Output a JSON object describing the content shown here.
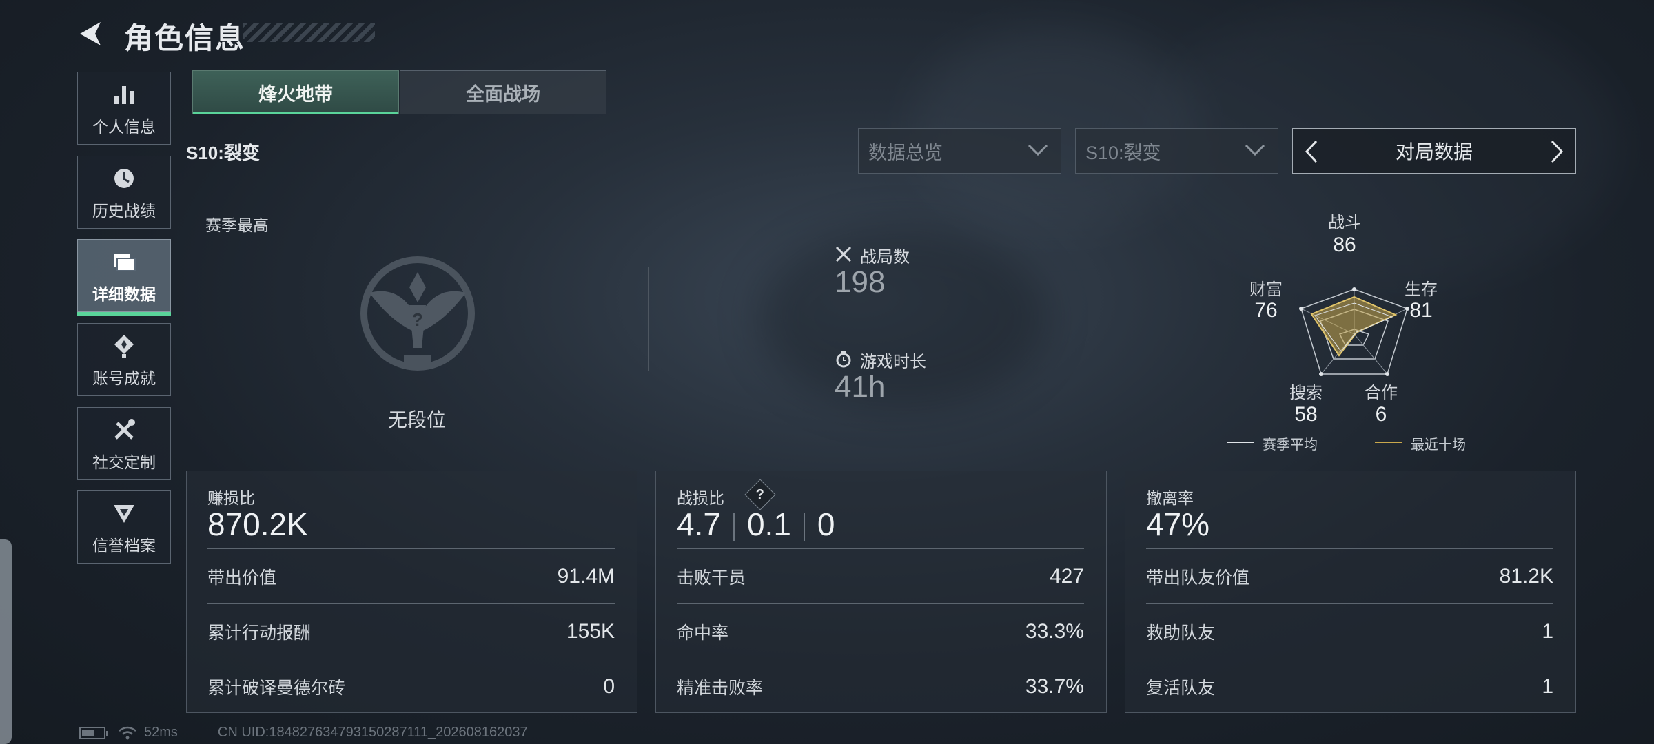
{
  "header": {
    "title": "角色信息"
  },
  "sidebar": {
    "items": [
      {
        "label": "个人信息",
        "icon": "bar-chart-icon",
        "active": false
      },
      {
        "label": "历史战绩",
        "icon": "history-icon",
        "active": false
      },
      {
        "label": "详细数据",
        "icon": "folder-icon",
        "active": true
      },
      {
        "label": "账号成就",
        "icon": "achievement-icon",
        "active": false
      },
      {
        "label": "社交定制",
        "icon": "tools-icon",
        "active": false
      },
      {
        "label": "信誉档案",
        "icon": "reputation-icon",
        "active": false
      }
    ]
  },
  "mode_tabs": [
    {
      "label": "烽火地带",
      "active": true
    },
    {
      "label": "全面战场",
      "active": false
    }
  ],
  "season": {
    "label": "S10:裂变"
  },
  "filters": {
    "overview": "数据总览",
    "season": "S10:裂变",
    "match_data": "对局数据"
  },
  "summary": {
    "season_best_label": "赛季最高",
    "rank": "无段位",
    "matches_label": "战局数",
    "matches_value": "198",
    "playtime_label": "游戏时长",
    "playtime_value": "41h"
  },
  "radar": {
    "axes": [
      {
        "label": "战斗",
        "value": "86"
      },
      {
        "label": "生存",
        "value": "81"
      },
      {
        "label": "合作",
        "value": "6"
      },
      {
        "label": "搜索",
        "value": "58"
      },
      {
        "label": "财富",
        "value": "76"
      }
    ],
    "legend_avg": "赛季平均",
    "legend_recent": "最近十场",
    "recent_color": "#c9a84c",
    "avg_color": "#e0e4e8"
  },
  "panels": {
    "profit": {
      "title": "赚损比",
      "big": "870.2K",
      "rows": [
        {
          "k": "带出价值",
          "v": "91.4M"
        },
        {
          "k": "累计行动报酬",
          "v": "155K"
        },
        {
          "k": "累计破译曼德尔砖",
          "v": "0"
        }
      ]
    },
    "kd": {
      "title": "战损比",
      "help": "?",
      "big_values": [
        "4.7",
        "0.1",
        "0"
      ],
      "rows": [
        {
          "k": "击败干员",
          "v": "427"
        },
        {
          "k": "命中率",
          "v": "33.3%"
        },
        {
          "k": "精准击败率",
          "v": "33.7%"
        }
      ]
    },
    "extract": {
      "title": "撤离率",
      "big": "47%",
      "rows": [
        {
          "k": "带出队友价值",
          "v": "81.2K"
        },
        {
          "k": "救助队友",
          "v": "1"
        },
        {
          "k": "复活队友",
          "v": "1"
        }
      ]
    }
  },
  "footer": {
    "ping": "52ms",
    "uid": "CN UID:184827634793150287111_202608162037",
    "battery_level": 0.6
  },
  "accent_color": "#5ad49a"
}
